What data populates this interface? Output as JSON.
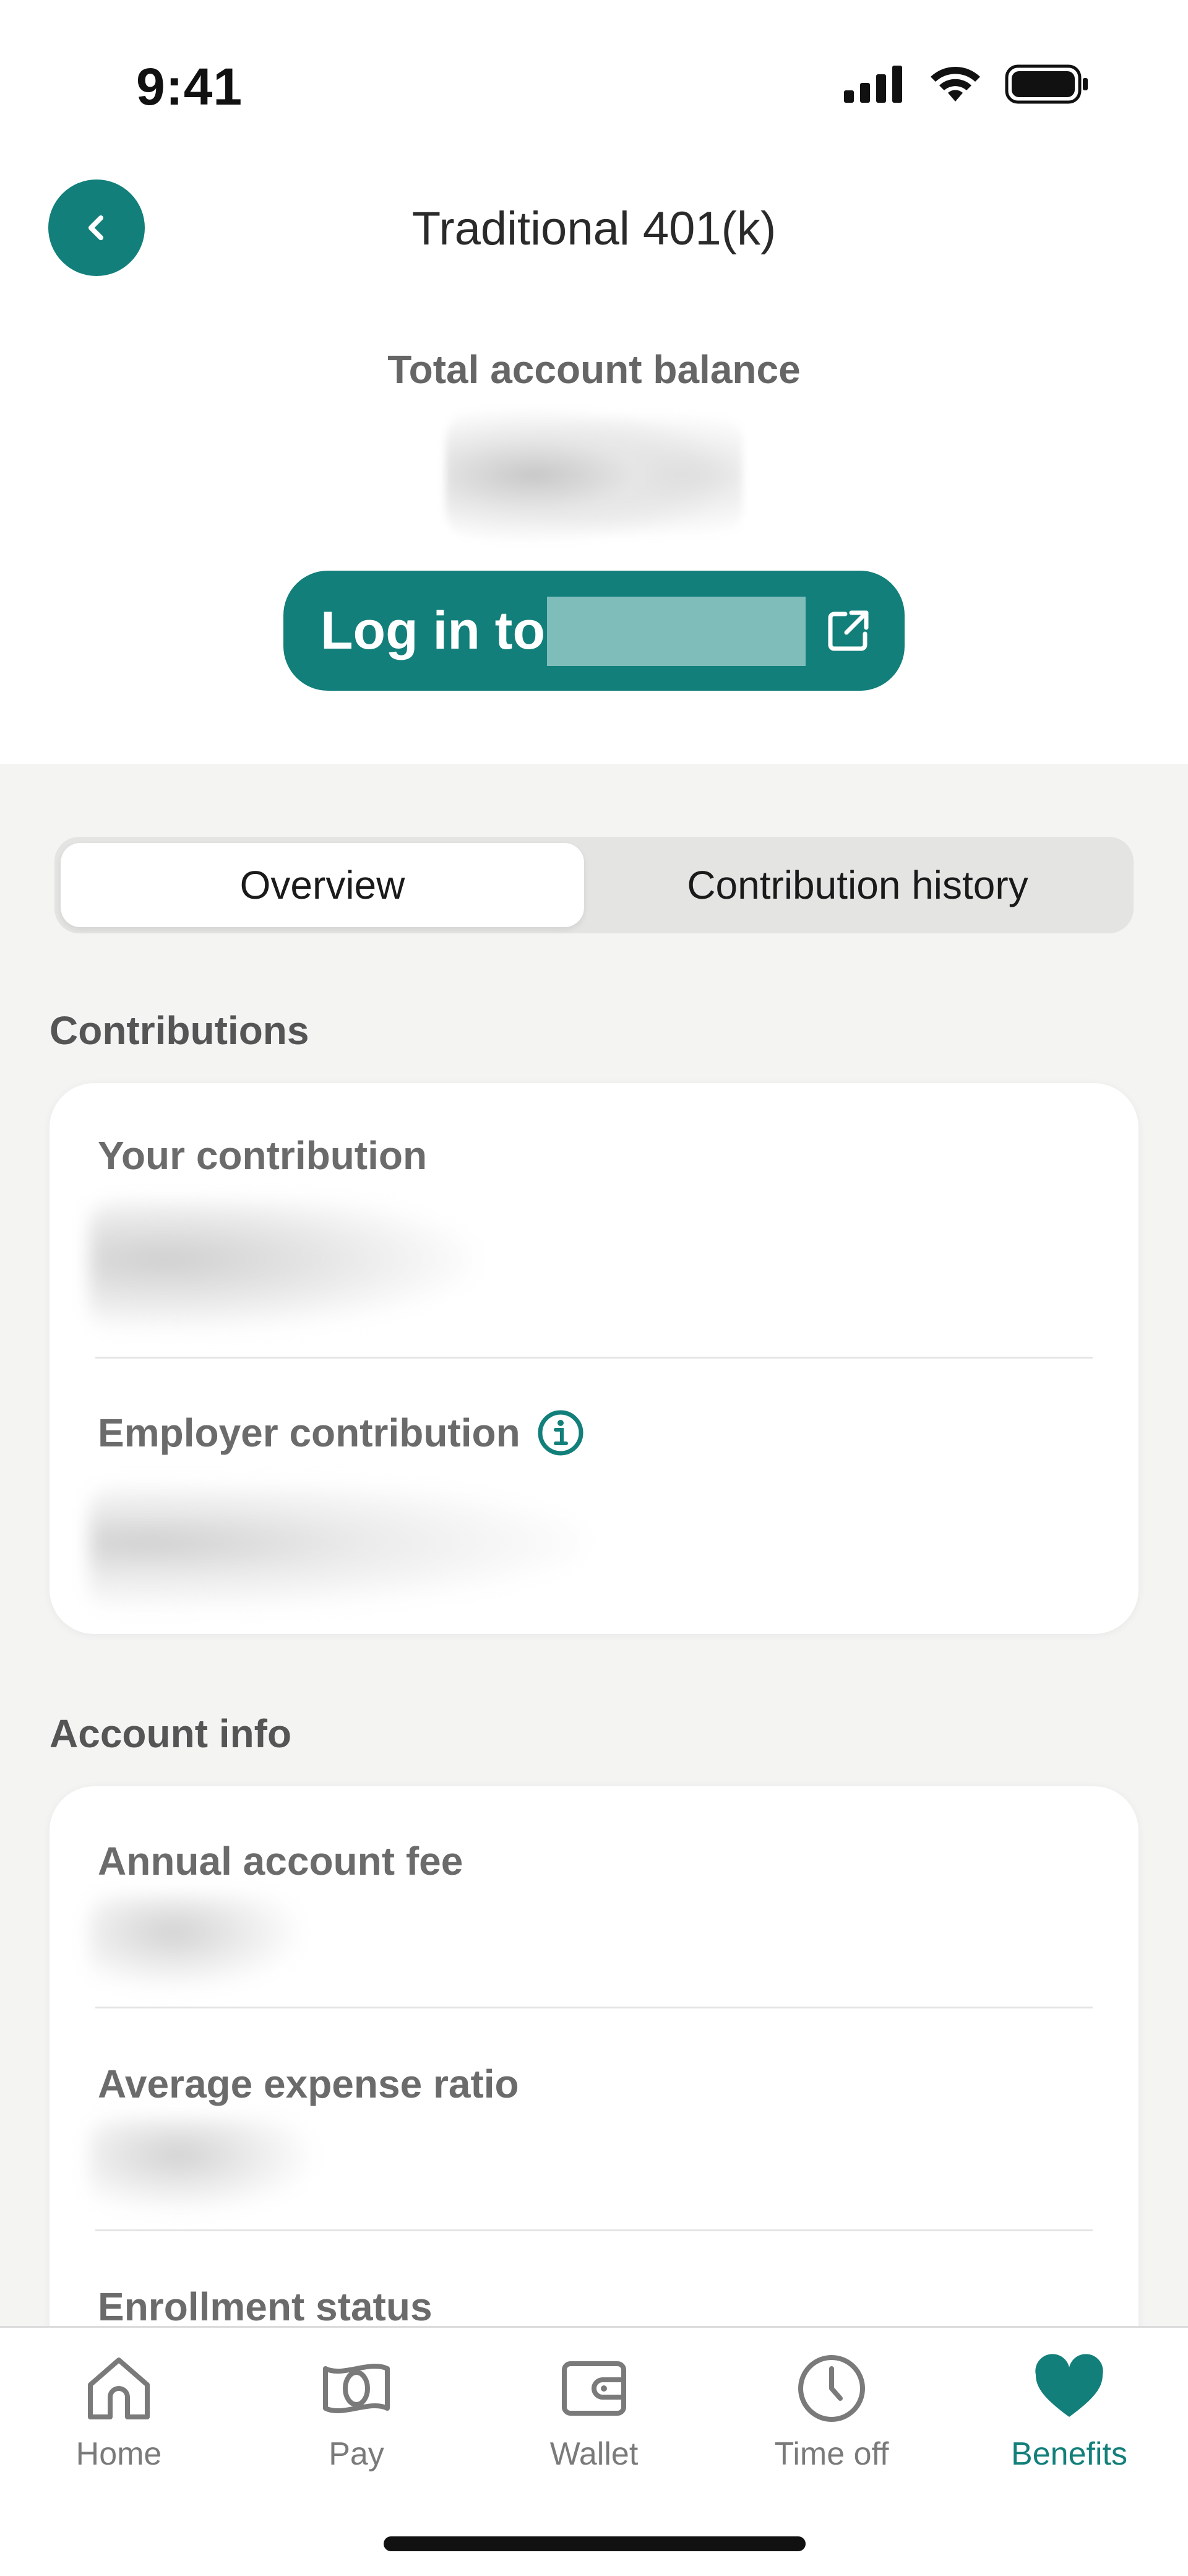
{
  "status_bar": {
    "time": "9:41"
  },
  "header": {
    "title": "Traditional 401(k)",
    "back_icon": "chevron-left-icon"
  },
  "balance": {
    "label": "Total account balance"
  },
  "login": {
    "label": "Log in to",
    "icon": "external-link-icon"
  },
  "tabs": [
    {
      "label": "Overview",
      "active": true
    },
    {
      "label": "Contribution history",
      "active": false
    }
  ],
  "contributions": {
    "heading": "Contributions",
    "your_contribution_label": "Your contribution",
    "employer_contribution_label": "Employer contribution",
    "info_icon": "info-icon"
  },
  "account_info": {
    "heading": "Account info",
    "annual_fee_label": "Annual account fee",
    "expense_ratio_label": "Average expense ratio",
    "enrollment_status_label": "Enrollment status"
  },
  "tabbar": {
    "items": [
      {
        "label": "Home",
        "icon": "home-icon"
      },
      {
        "label": "Pay",
        "icon": "pay-icon"
      },
      {
        "label": "Wallet",
        "icon": "wallet-icon"
      },
      {
        "label": "Time off",
        "icon": "clock-icon"
      },
      {
        "label": "Benefits",
        "icon": "heart-icon",
        "active": true
      }
    ]
  },
  "colors": {
    "accent": "#127f7a",
    "background": "#f4f4f3"
  }
}
